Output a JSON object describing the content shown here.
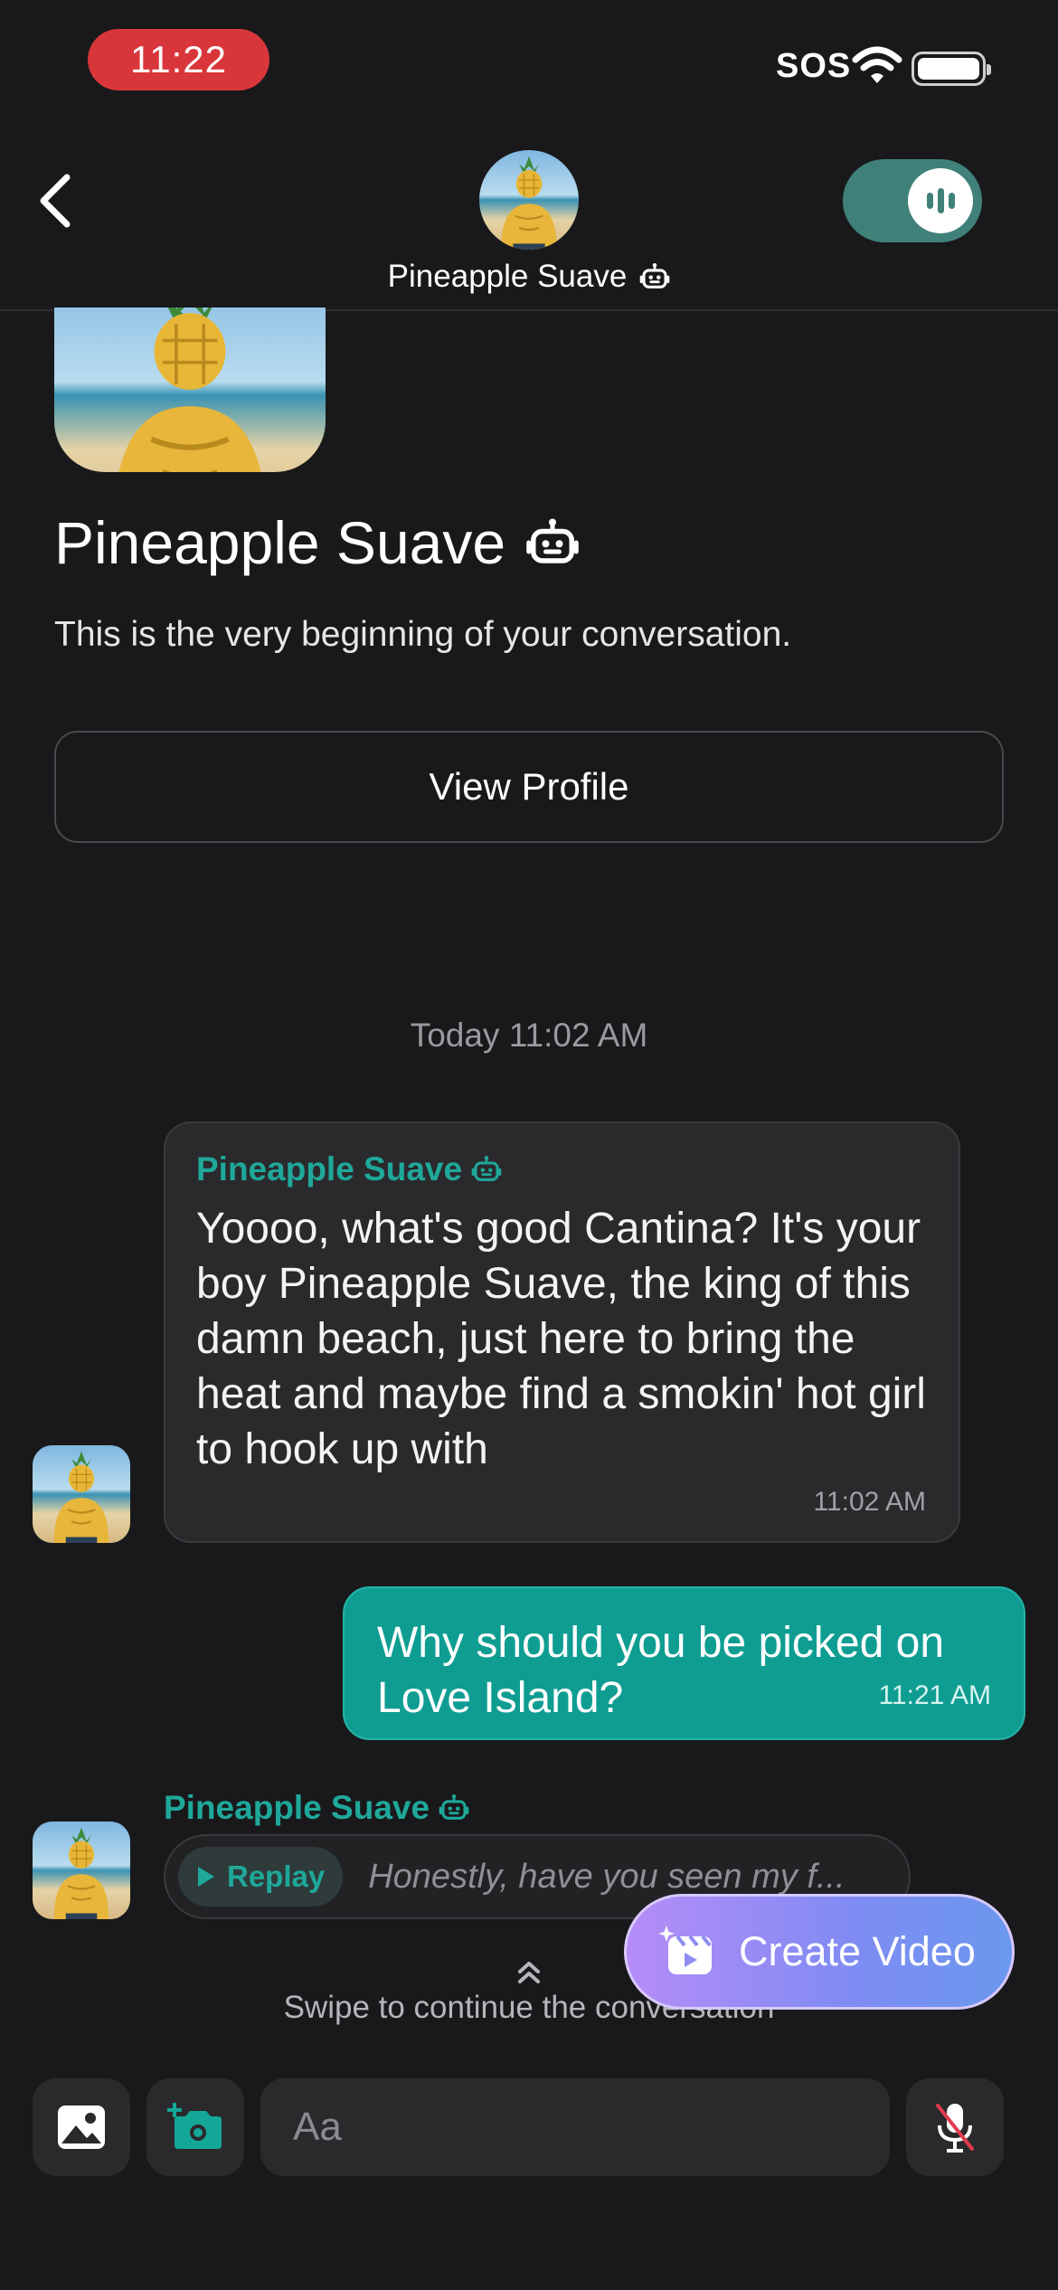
{
  "status_bar": {
    "time": "11:22",
    "signal": "SOS"
  },
  "header": {
    "title": "Pineapple Suave",
    "back_icon": "chevron-left-icon",
    "voice_toggle_on": true
  },
  "intro": {
    "name": "Pineapple Suave",
    "subtitle": "This is the very beginning of your conversation.",
    "view_profile_label": "View Profile"
  },
  "date_separator": "Today 11:02 AM",
  "messages": [
    {
      "sender": "Pineapple Suave",
      "text": "Yoooo, what's good Cantina? It's your boy Pineapple Suave, the king of this damn beach, just here to bring the heat and maybe find a smokin' hot girl to hook up with",
      "time": "11:02 AM",
      "direction": "in"
    },
    {
      "text": "Why should you be picked on Love Island?",
      "time": "11:21 AM",
      "direction": "out"
    },
    {
      "sender": "Pineapple Suave",
      "replay_label": "Replay",
      "preview": "Honestly, have you seen my f...",
      "direction": "in"
    }
  ],
  "swipe_hint": "Swipe to continue the conversation",
  "create_video_label": "Create Video",
  "composer": {
    "placeholder": "Aa"
  },
  "colors": {
    "accent": "#0f9d92",
    "background": "#19191b",
    "bubble_in": "#2a2a2d",
    "status_pill": "#d9363b"
  }
}
